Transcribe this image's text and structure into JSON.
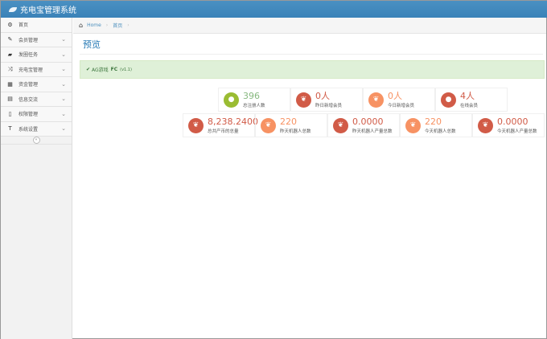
{
  "app": {
    "title": "充电宝管理系统"
  },
  "sidebar": {
    "items": [
      {
        "label": "首页",
        "icon": "dashboard-icon"
      },
      {
        "label": "会员管理",
        "icon": "edit-icon"
      },
      {
        "label": "发圈任务",
        "icon": "book-icon"
      },
      {
        "label": "充电宝管理",
        "icon": "random-icon"
      },
      {
        "label": "资金管理",
        "icon": "calendar-icon"
      },
      {
        "label": "信息交流",
        "icon": "list-icon"
      },
      {
        "label": "权限管理",
        "icon": "file-icon"
      },
      {
        "label": "系统设置",
        "icon": "text-icon"
      }
    ]
  },
  "breadcrumb": {
    "home": "Home",
    "current": "首页"
  },
  "page": {
    "title": "预览"
  },
  "alert": {
    "text": "AG游戏",
    "bold": "FC",
    "version": "(v1.1)"
  },
  "stats_row1": [
    {
      "value": "396",
      "label": "总注册人数",
      "color": "green",
      "icon": "comments-icon"
    },
    {
      "value": "0人",
      "label": "昨日新增会员",
      "color": "red",
      "icon": "twitter-icon"
    },
    {
      "value": "0人",
      "label": "今日新增会员",
      "color": "orange",
      "icon": "twitter-icon"
    },
    {
      "value": "4人",
      "label": "在线会员",
      "color": "red",
      "icon": "comments-icon"
    }
  ],
  "stats_row2": [
    {
      "value": "8,238.2400",
      "label": "总共产币的总量",
      "color": "red",
      "icon": "twitter-icon"
    },
    {
      "value": "220",
      "label": "昨天机器人总数",
      "color": "orange",
      "icon": "twitter-icon"
    },
    {
      "value": "0.0000",
      "label": "昨天机器人产量总数",
      "color": "red",
      "icon": "twitter-icon"
    },
    {
      "value": "220",
      "label": "今天机器人总数",
      "color": "orange",
      "icon": "twitter-icon"
    },
    {
      "value": "0.0000",
      "label": "今天机器人产量总数",
      "color": "red",
      "icon": "twitter-icon"
    }
  ],
  "colors": {
    "header": "#428bca",
    "green": "#9abc32",
    "red": "#d15b47",
    "orange": "#f79263"
  }
}
